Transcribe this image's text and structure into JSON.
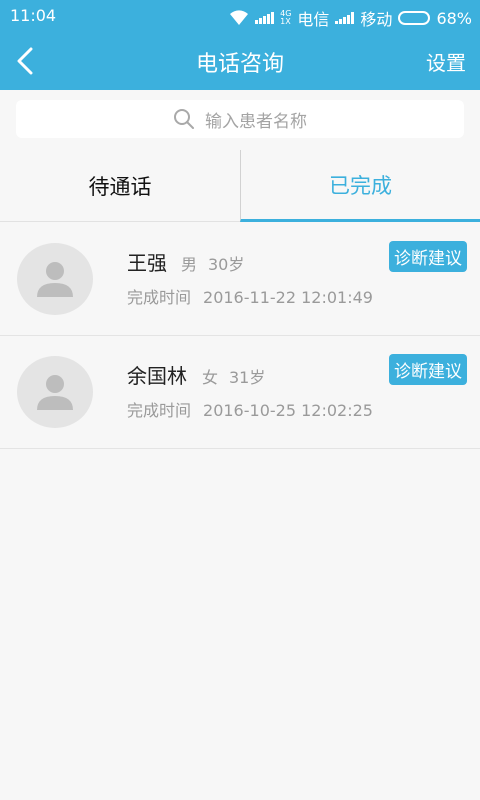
{
  "status_bar": {
    "time": "11:04",
    "net_top": "4G",
    "net_bottom": "1X",
    "carrier1": "电信",
    "carrier2": "移动",
    "battery": "68%",
    "battery_level": 0.68
  },
  "nav": {
    "title": "电话咨询",
    "settings_label": "设置"
  },
  "search": {
    "placeholder": "输入患者名称"
  },
  "tabs": [
    {
      "label": "待通话",
      "active": false
    },
    {
      "label": "已完成",
      "active": true
    }
  ],
  "records": [
    {
      "name": "王强",
      "gender": "男",
      "age": "30岁",
      "done_label": "完成时间",
      "time": "2016-11-22 12:01:49",
      "action": "诊断建议"
    },
    {
      "name": "余国林",
      "gender": "女",
      "age": "31岁",
      "done_label": "完成时间",
      "time": "2016-10-25 12:02:25",
      "action": "诊断建议"
    }
  ],
  "colors": {
    "accent": "#3cb0dd",
    "background": "#f7f7f7",
    "muted_text": "#9a9a9a"
  }
}
